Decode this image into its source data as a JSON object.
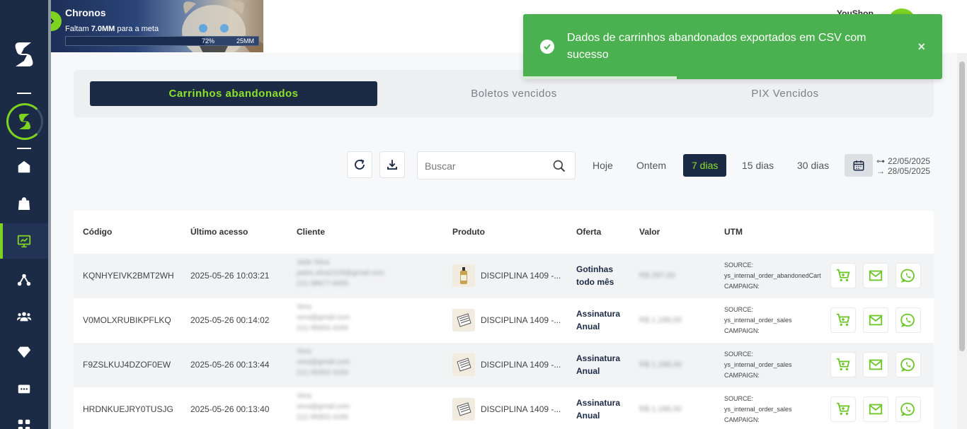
{
  "banner": {
    "title": "Chronos",
    "subtitle_prefix": "Faltam",
    "subtitle_amount": "7.0MM",
    "subtitle_suffix": "para a meta",
    "progress_label": "72%",
    "progress_value": 0.72,
    "goal": "25MM"
  },
  "header": {
    "user_name": "YouShop"
  },
  "tabs": [
    {
      "label": "Carrinhos abandonados",
      "active": true
    },
    {
      "label": "Boletos vencidos",
      "active": false
    },
    {
      "label": "PIX Vencidos",
      "active": false
    }
  ],
  "toolbar": {
    "refresh_icon": "refresh-icon",
    "download_icon": "download-icon",
    "search_placeholder": "Buscar",
    "ranges": [
      {
        "label": "Hoje",
        "active": false
      },
      {
        "label": "Ontem",
        "active": false
      },
      {
        "label": "7 dias",
        "active": true
      },
      {
        "label": "15 dias",
        "active": false
      },
      {
        "label": "30 dias",
        "active": false
      }
    ],
    "date_from": "22/05/2025",
    "date_to": "28/05/2025"
  },
  "table": {
    "headers": [
      "Código",
      "Último acesso",
      "Cliente",
      "Produto",
      "Oferta",
      "Valor",
      "UTM"
    ],
    "rows": [
      {
        "code": "KQNHYEIVK2BMT2WH",
        "last_access": "2025-05-26 10:03:21",
        "client_name": "Jade Silva",
        "client_email": "jades.silva2118@gmail.com",
        "client_phone": "(11) 98877-6655",
        "product": "DISCIPLINA 1409 -...",
        "product_icon": "bottle-icon",
        "offer_line1": "Gotinhas",
        "offer_line2": "todo mês",
        "value": "R$ 297,00",
        "utm_source_label": "SOURCE:",
        "utm_source": "ys_internal_order_abandonedCart",
        "utm_campaign_label": "CAMPAIGN:"
      },
      {
        "code": "V0MOLXRUBIKPFLKQ",
        "last_access": "2025-05-26 00:14:02",
        "client_name": "Vera",
        "client_email": "vera@gmail.com",
        "client_phone": "(11) 99302-4184",
        "product": "DISCIPLINA 1409 -...",
        "product_icon": "calendar-product-icon",
        "offer_line1": "Assinatura",
        "offer_line2": "Anual",
        "value": "R$ 1.188,00",
        "utm_source_label": "SOURCE:",
        "utm_source": "ys_internal_order_sales",
        "utm_campaign_label": "CAMPAIGN:"
      },
      {
        "code": "F9ZSLKUJ4DZOF0EW",
        "last_access": "2025-05-26 00:13:44",
        "client_name": "Vera",
        "client_email": "vera@gmail.com",
        "client_phone": "(11) 99302-4184",
        "product": "DISCIPLINA 1409 -...",
        "product_icon": "calendar-product-icon",
        "offer_line1": "Assinatura",
        "offer_line2": "Anual",
        "value": "R$ 1.188,00",
        "utm_source_label": "SOURCE:",
        "utm_source": "ys_internal_order_sales",
        "utm_campaign_label": "CAMPAIGN:"
      },
      {
        "code": "HRDNKUEJRY0TUSJG",
        "last_access": "2025-05-26 00:13:40",
        "client_name": "Vera",
        "client_email": "vera@gmail.com",
        "client_phone": "(11) 99302-4184",
        "product": "DISCIPLINA 1409 -...",
        "product_icon": "calendar-product-icon",
        "offer_line1": "Assinatura",
        "offer_line2": "Anual",
        "value": "R$ 1.188,00",
        "utm_source_label": "SOURCE:",
        "utm_source": "ys_internal_order_sales",
        "utm_campaign_label": "CAMPAIGN:"
      }
    ],
    "row_actions": [
      "cart-icon",
      "mail-icon",
      "whatsapp-icon"
    ]
  },
  "toast": {
    "message": "Dados de carrinhos abandonados exportados em CSV com sucesso",
    "close": "×",
    "type": "success"
  },
  "colors": {
    "sidebar": "#1b2a45",
    "accent": "#7ed321",
    "toast": "#4bb04f"
  }
}
